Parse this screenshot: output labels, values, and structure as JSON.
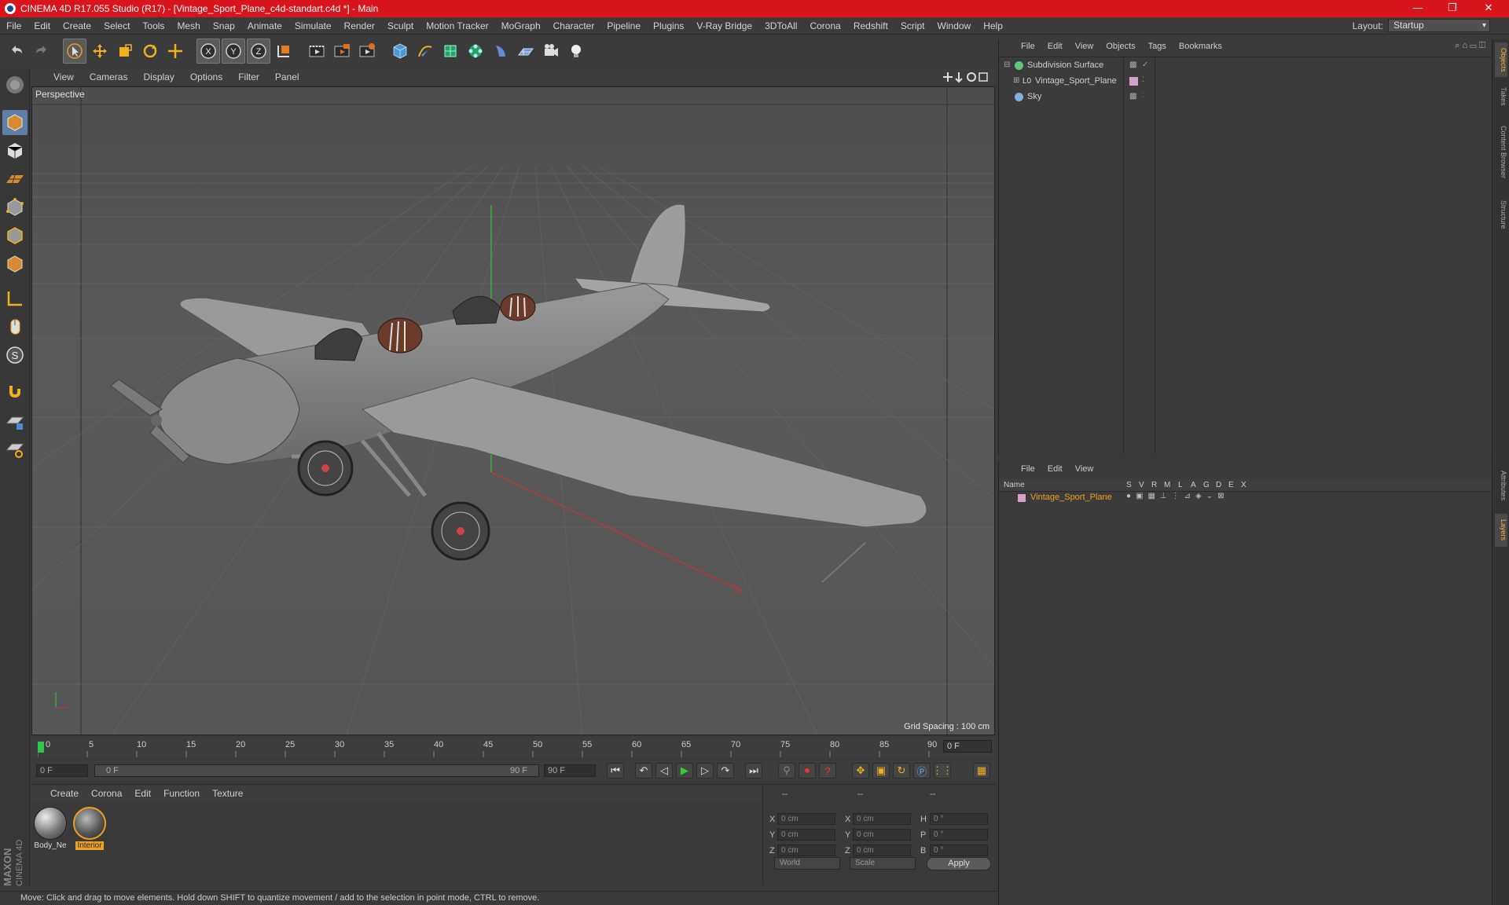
{
  "window": {
    "title": "CINEMA 4D R17.055 Studio (R17) - [Vintage_Sport_Plane_c4d-standart.c4d *] - Main",
    "min": "—",
    "max": "❐",
    "close": "✕"
  },
  "menu": [
    "File",
    "Edit",
    "Create",
    "Select",
    "Tools",
    "Mesh",
    "Snap",
    "Animate",
    "Simulate",
    "Render",
    "Sculpt",
    "Motion Tracker",
    "MoGraph",
    "Character",
    "Pipeline",
    "Plugins",
    "V-Ray Bridge",
    "3DToAll",
    "Corona",
    "Redshift",
    "Script",
    "Window",
    "Help"
  ],
  "layout": {
    "label": "Layout:",
    "value": "Startup"
  },
  "toolbar": {
    "icons": [
      "undo-icon",
      "redo-icon",
      "select-arrow-icon",
      "move-icon",
      "scale-icon",
      "rotate-icon",
      "move-axis-icon",
      "x-axis-icon",
      "y-axis-icon",
      "z-axis-icon",
      "coordinate-system-icon",
      "render-view-icon",
      "render-picture-viewer-icon",
      "render-settings-icon",
      "cube-icon",
      "pen-spline-icon",
      "subdivision-icon",
      "mograph-cloner-icon",
      "deformer-icon",
      "floor-icon",
      "camera-icon",
      "light-icon"
    ],
    "axis_x": "X",
    "axis_y": "Y",
    "axis_z": "Z"
  },
  "viewport": {
    "menu": [
      "View",
      "Cameras",
      "Display",
      "Options",
      "Filter",
      "Panel"
    ],
    "label": "Perspective",
    "grid_spacing": "Grid Spacing : 100 cm"
  },
  "timeline": {
    "ticks": [
      "0",
      "5",
      "10",
      "15",
      "20",
      "25",
      "30",
      "35",
      "40",
      "45",
      "50",
      "55",
      "60",
      "65",
      "70",
      "75",
      "80",
      "85",
      "90"
    ],
    "current_frame": "0 F"
  },
  "transport": {
    "start": "0 F",
    "range_start": "0 F",
    "range_end": "90 F",
    "end": "90 F"
  },
  "material_manager": {
    "menu": [
      "Create",
      "Corona",
      "Edit",
      "Function",
      "Texture"
    ],
    "materials": [
      {
        "name": "Body_Ne",
        "selected": false
      },
      {
        "name": "Interior",
        "selected": true
      }
    ]
  },
  "coordinates": {
    "headers": [
      "--",
      "--",
      "--"
    ],
    "rows": [
      {
        "l1": "X",
        "v1": "0 cm",
        "l2": "X",
        "v2": "0 cm",
        "l3": "H",
        "v3": "0 °"
      },
      {
        "l1": "Y",
        "v1": "0 cm",
        "l2": "Y",
        "v2": "0 cm",
        "l3": "P",
        "v3": "0 °"
      },
      {
        "l1": "Z",
        "v1": "0 cm",
        "l2": "Z",
        "v2": "0 cm",
        "l3": "B",
        "v3": "0 °"
      }
    ],
    "mode": "World",
    "scale": "Scale",
    "apply": "Apply"
  },
  "object_manager": {
    "menu": [
      "File",
      "Edit",
      "View",
      "Objects",
      "Tags",
      "Bookmarks"
    ],
    "objects": [
      {
        "name": "Subdivision Surface",
        "icon": "subdivision-icon",
        "color": "#5cc87a"
      },
      {
        "name": "Vintage_Sport_Plane",
        "icon": "null-object-icon",
        "color": "#d8a0c8"
      },
      {
        "name": "Sky",
        "icon": "sky-icon",
        "color": "#7fb0e0"
      }
    ]
  },
  "layer_manager": {
    "menu": [
      "File",
      "Edit",
      "View"
    ],
    "columns": [
      "Name",
      "S",
      "V",
      "R",
      "M",
      "L",
      "A",
      "G",
      "D",
      "E",
      "X"
    ],
    "layers": [
      {
        "name": "Vintage_Sport_Plane"
      }
    ]
  },
  "right_tabs": [
    "Objects",
    "Takes",
    "Content Browser",
    "Structure",
    "Attributes",
    "Layers"
  ],
  "status": "Move: Click and drag to move elements. Hold down SHIFT to quantize movement / add to the selection in point mode, CTRL to remove.",
  "brand": {
    "line1": "MAXON",
    "line2": "CINEMA 4D"
  },
  "colors": {
    "titlebar": "#d8141c",
    "accent": "#f0a020",
    "selected_tool": "#5f7fa8"
  }
}
